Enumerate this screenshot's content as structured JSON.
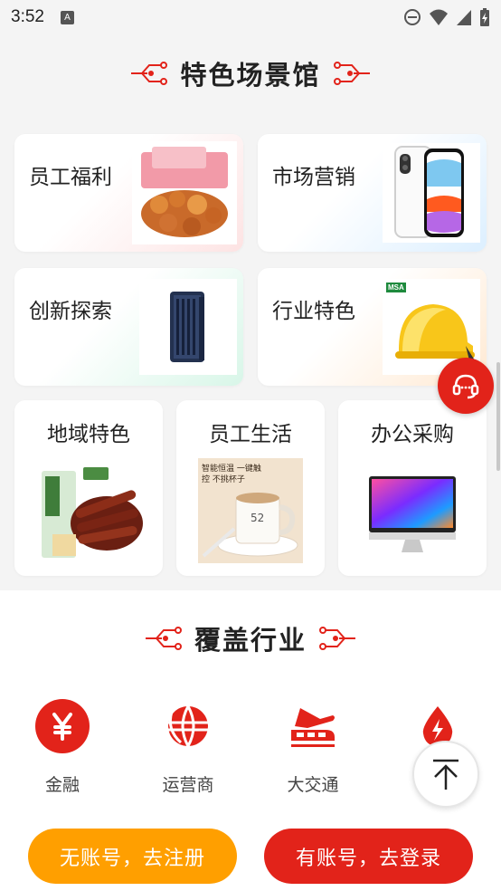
{
  "status": {
    "time": "3:52",
    "notif_glyph": "A"
  },
  "scenes": {
    "title": "特色场景馆",
    "cards": [
      {
        "label": "员工福利",
        "img": "snack-gift-box"
      },
      {
        "label": "市场营销",
        "img": "smartphone"
      },
      {
        "label": "创新探索",
        "img": "router-device"
      },
      {
        "label": "行业特色",
        "img": "safety-helmet",
        "img_brand": "MSA"
      },
      {
        "label": "地域特色",
        "img": "beef-jerky"
      },
      {
        "label": "员工生活",
        "img": "warming-mug",
        "img_text": "智能恒温 一键触控 不挑杯子"
      },
      {
        "label": "办公采购",
        "img": "desktop-monitor"
      }
    ]
  },
  "industry": {
    "title": "覆盖行业",
    "items": [
      {
        "label": "金融",
        "icon": "yuan-icon",
        "color": "#e2231a"
      },
      {
        "label": "运营商",
        "icon": "globe-icon",
        "color": "#e2231a"
      },
      {
        "label": "大交通",
        "icon": "transport-icon",
        "color": "#e2231a"
      },
      {
        "label": "",
        "icon": "energy-icon",
        "color": "#e2231a"
      }
    ]
  },
  "buttons": {
    "register": "无账号，去注册",
    "login": "有账号，去登录"
  },
  "colors": {
    "accent": "#e2231a",
    "orange": "#ff9f00"
  }
}
